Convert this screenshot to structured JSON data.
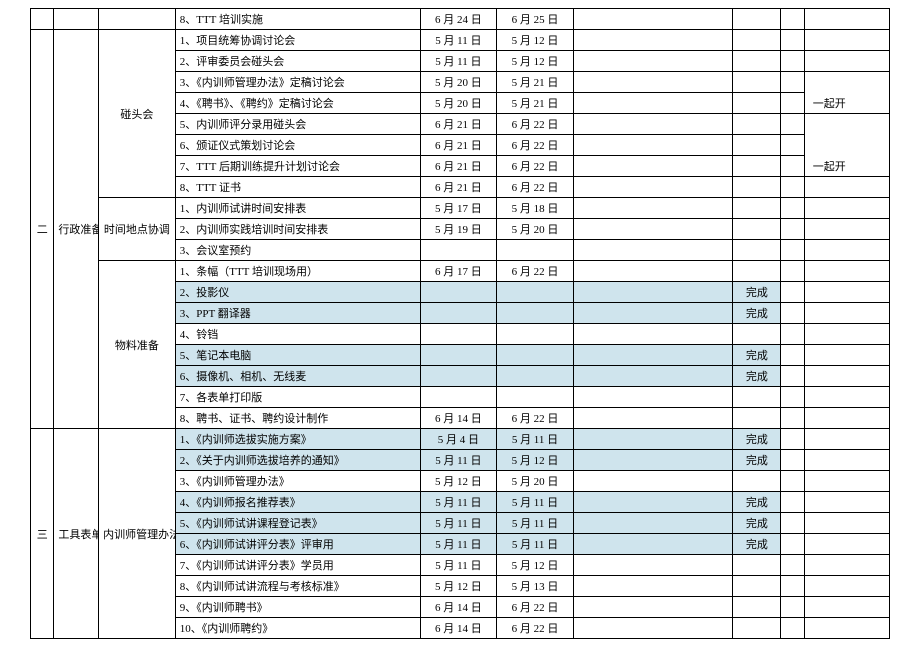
{
  "sections": {
    "s1": {
      "idx": "",
      "cat": ""
    },
    "s2": {
      "idx": "二",
      "cat": "行政准备"
    },
    "s3": {
      "idx": "三",
      "cat": "工具表单"
    }
  },
  "subs": {
    "pre": "",
    "touch": "碰头会",
    "time": "时间地点协调",
    "mat": "物料准备",
    "mgmt": "内训师管理办法"
  },
  "r": {
    "r0": {
      "task": "8、TTT 培训实施",
      "d1": "6 月 24 日",
      "d2": "6 月 25 日",
      "stat": "",
      "note": ""
    },
    "r1": {
      "task": "1、项目统筹协调讨论会",
      "d1": "5 月 11 日",
      "d2": "5 月 12 日",
      "stat": "",
      "note": ""
    },
    "r2": {
      "task": "2、评审委员会碰头会",
      "d1": "5 月 11 日",
      "d2": "5 月 12 日",
      "stat": "",
      "note": ""
    },
    "r3": {
      "task": "3、《内训师管理办法》定稿讨论会",
      "d1": "5 月 20 日",
      "d2": "5 月 21 日",
      "stat": "",
      "note": ""
    },
    "r4": {
      "task": "4、《聘书》、《聘约》定稿讨论会",
      "d1": "5 月 20 日",
      "d2": "5 月 21 日",
      "stat": "",
      "note": "一起开"
    },
    "r5": {
      "task": "5、内训师评分录用碰头会",
      "d1": "6 月 21 日",
      "d2": "6 月 22 日",
      "stat": "",
      "note": ""
    },
    "r6": {
      "task": "6、颁证仪式策划讨论会",
      "d1": "6 月 21 日",
      "d2": "6 月 22 日",
      "stat": "",
      "note": ""
    },
    "r7": {
      "task": "7、TTT 后期训练提升计划讨论会",
      "d1": "6 月 21 日",
      "d2": "6 月 22 日",
      "stat": "",
      "note": "一起开"
    },
    "r8": {
      "task": "8、TTT 证书",
      "d1": "6 月 21 日",
      "d2": "6 月 22 日",
      "stat": "",
      "note": ""
    },
    "r9": {
      "task": "1、内训师试讲时间安排表",
      "d1": "5 月 17 日",
      "d2": "5 月 18 日",
      "stat": "",
      "note": ""
    },
    "r10": {
      "task": "2、内训师实践培训时间安排表",
      "d1": "5 月 19 日",
      "d2": "5 月 20 日",
      "stat": "",
      "note": ""
    },
    "r11": {
      "task": "3、会议室预约",
      "d1": "",
      "d2": "",
      "stat": "",
      "note": ""
    },
    "r12": {
      "task": "1、条幅（TTT 培训现场用）",
      "d1": "6 月 17 日",
      "d2": "6 月 22 日",
      "stat": "",
      "note": ""
    },
    "r13": {
      "task": "2、投影仪",
      "d1": "",
      "d2": "",
      "stat": "完成",
      "note": ""
    },
    "r14": {
      "task": "3、PPT 翻译器",
      "d1": "",
      "d2": "",
      "stat": "完成",
      "note": ""
    },
    "r15": {
      "task": "4、铃铛",
      "d1": "",
      "d2": "",
      "stat": "",
      "note": ""
    },
    "r16": {
      "task": "5、笔记本电脑",
      "d1": "",
      "d2": "",
      "stat": "完成",
      "note": ""
    },
    "r17": {
      "task": "6、摄像机、相机、无线麦",
      "d1": "",
      "d2": "",
      "stat": "完成",
      "note": ""
    },
    "r18": {
      "task": "7、各表单打印版",
      "d1": "",
      "d2": "",
      "stat": "",
      "note": ""
    },
    "r19": {
      "task": "8、聘书、证书、聘约设计制作",
      "d1": "6 月 14 日",
      "d2": "6 月 22 日",
      "stat": "",
      "note": ""
    },
    "r20": {
      "task": "1、《内训师选拔实施方案》",
      "d1": "5 月 4 日",
      "d2": "5 月 11 日",
      "stat": "完成",
      "note": ""
    },
    "r21": {
      "task": "2、《关于内训师选拔培养的通知》",
      "d1": "5 月 11 日",
      "d2": "5 月 12 日",
      "stat": "完成",
      "note": ""
    },
    "r22": {
      "task": "3、《内训师管理办法》",
      "d1": "5 月 12 日",
      "d2": "5 月 20 日",
      "stat": "",
      "note": ""
    },
    "r23": {
      "task": "4、《内训师报名推荐表》",
      "d1": "5 月 11 日",
      "d2": "5 月 11 日",
      "stat": "完成",
      "note": ""
    },
    "r24": {
      "task": "5、《内训师试讲课程登记表》",
      "d1": "5 月 11 日",
      "d2": "5 月 11 日",
      "stat": "完成",
      "note": ""
    },
    "r25": {
      "task": "6、《内训师试讲评分表》评审用",
      "d1": "5 月 11 日",
      "d2": "5 月 11 日",
      "stat": "完成",
      "note": ""
    },
    "r26": {
      "task": "7、《内训师试讲评分表》学员用",
      "d1": "5 月 11 日",
      "d2": "5 月 12 日",
      "stat": "",
      "note": ""
    },
    "r27": {
      "task": "8、《内训师试讲流程与考核标准》",
      "d1": "5 月 12 日",
      "d2": "5 月 13 日",
      "stat": "",
      "note": ""
    },
    "r28": {
      "task": "9、《内训师聘书》",
      "d1": "6 月 14 日",
      "d2": "6 月 22 日",
      "stat": "",
      "note": ""
    },
    "r29": {
      "task": "10、《内训师聘约》",
      "d1": "6 月 14 日",
      "d2": "6 月 22 日",
      "stat": "",
      "note": ""
    }
  }
}
